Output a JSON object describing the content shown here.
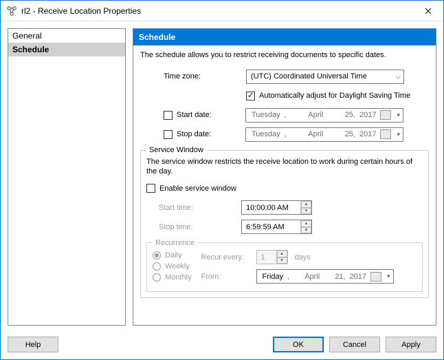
{
  "window": {
    "title": "rl2 - Receive Location Properties"
  },
  "sidebar": {
    "items": [
      {
        "label": "General",
        "selected": false
      },
      {
        "label": "Schedule",
        "selected": true
      }
    ]
  },
  "panel": {
    "header": "Schedule",
    "description": "The schedule allows you to restrict receiving documents to specific dates.",
    "timezone": {
      "label": "Time zone:",
      "value": "(UTC) Coordinated Universal Time",
      "dst_label": "Automatically adjust for Daylight Saving Time",
      "dst_checked": true
    },
    "start_date": {
      "label": "Start date:",
      "checked": false,
      "weekday": "Tuesday",
      "month": "April",
      "day": "25,",
      "year": "2017"
    },
    "stop_date": {
      "label": "Stop date:",
      "checked": false,
      "weekday": "Tuesday",
      "month": "April",
      "day": "25,",
      "year": "2017"
    },
    "service_window": {
      "legend": "Service Window",
      "description": "The service window restricts the receive location to work during certain hours of the day.",
      "enable_label": "Enable service window",
      "enable_checked": false,
      "start_time": {
        "label": "Start time:",
        "value": "10:00:00 AM"
      },
      "stop_time": {
        "label": "Stop time:",
        "value": "6:59:59 AM"
      }
    },
    "recurrence": {
      "legend": "Recurrence",
      "options": {
        "daily": "Daily",
        "weekly": "Weekly",
        "monthly": "Monthly"
      },
      "selected": "daily",
      "recur_every_label": "Recur every:",
      "recur_every_value": "1",
      "recur_unit": "days",
      "from_label": "From:",
      "from_date": {
        "weekday": "Friday",
        "month": "April",
        "day": "21,",
        "year": "2017"
      }
    }
  },
  "buttons": {
    "help": "Help",
    "ok": "OK",
    "cancel": "Cancel",
    "apply": "Apply"
  }
}
